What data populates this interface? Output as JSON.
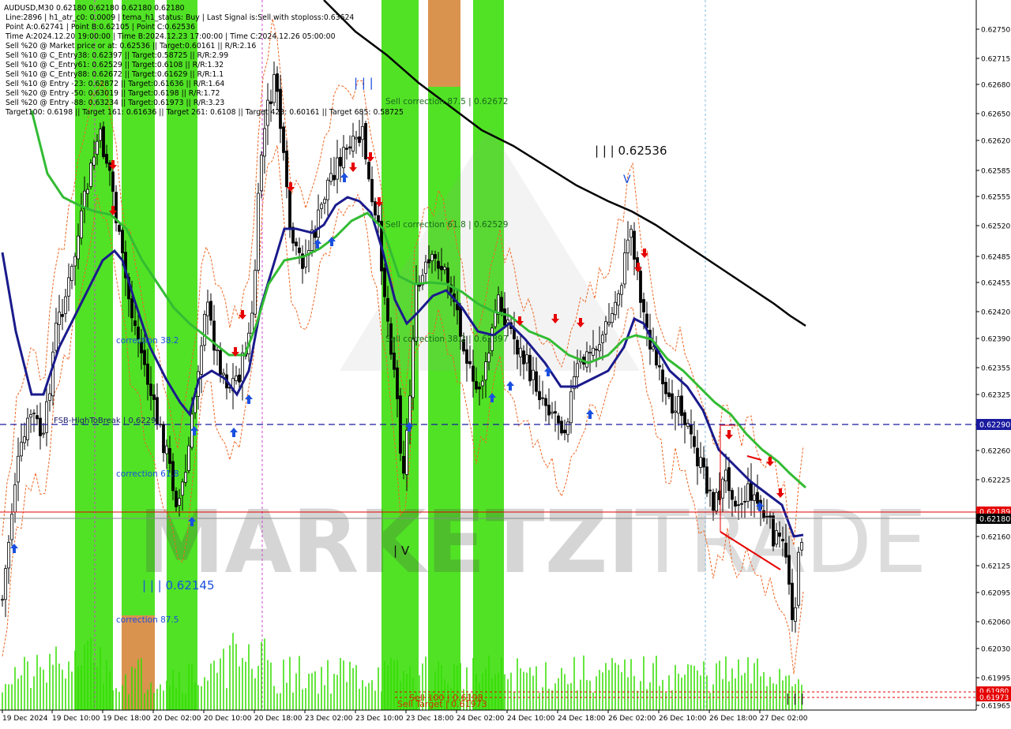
{
  "window": {
    "title": "AUDUSD,M30  0.62180 0.62180 0.62180 0.62180"
  },
  "info_lines": [
    "AUDUSD,M30  0.62180 0.62180 0.62180 0.62180",
    "Line:2896 | h1_atr_c0: 0.0009 | tema_h1_status: Buy | Last Signal is:Sell with stoploss:0.63624",
    "Point A:0.62741 | Point B:0.62105 | Point C:0.62536",
    "Time A:2024.12.20 19:00:00 | Time B:2024.12.23 17:00:00 | Time C:2024.12.26 05:00:00",
    "Sell %20 @ Market price or at: 0.62536 || Target:0.60161 || R/R:2.16",
    "Sell %10 @ C_Entry38: 0.62397 || Target:0.58725 || R/R:2.99",
    "Sell %10 @ C_Entry61: 0.62529 || Target:0.6108 || R/R:1.32",
    "Sell %10 @ C_Entry88: 0.62672 || Target:0.61629 || R/R:1.1",
    "Sell %10 @ Entry -23: 0.62872 || Target:0.61636 || R/R:1.64",
    "Sell %20 @ Entry -50: 0.63019 || Target:0.6198 || R/R:1.72",
    "Sell %20 @ Entry -88: 0.63234 || Target:0.61973 || R/R:3.23",
    "Target100: 0.6198 || Target 161: 0.61636 || Target 261: 0.6108 || Target 423: 0.60161 || Target 685: 0.58725"
  ],
  "watermark": {
    "text_left": "MARKETZI",
    "text_right": "TRADE"
  },
  "annotations": {
    "wave3_top": "| | |",
    "wave3_label": "| | | 0.62536",
    "wave3_low_label": "| | | 0.62145",
    "wave4_label": "| V",
    "wave_bottom": "| | |",
    "sell_corr_875": "Sell correction 87.5 | 0.62672",
    "sell_corr_618": "Sell correction 61.8 | 0.62529",
    "sell_corr_382": "Sell correction 38.2 | 0.62397",
    "corr_382": "correction 38.2",
    "corr_618": "correction 61.8",
    "corr_875": "correction 87.5",
    "fsb_label": "FSB-HighToBreak | 0.6229",
    "sell_100": "Sell 100 | 0.6198",
    "sell_target": "Sell Target | 0.61973"
  },
  "price_tags": {
    "fsb": "0.62290",
    "red_line": "0.62189",
    "current": "0.62180",
    "target_100": "0.61980",
    "target_2": "0.61973"
  },
  "colors": {
    "background": "#ffffff",
    "up_candle": "#000000",
    "down_candle": "#000000",
    "green_zone": "#33dd00",
    "orange_zone": "#d9934f",
    "ma_fast": "#1a1a8c",
    "ma_mid": "#33bb33",
    "ma_slow": "#000000",
    "fsb_line": "#1a1aa0",
    "sell_arrow": "#e60000",
    "buy_arrow": "#1a4fe0",
    "price_line": "#e60000",
    "volume": "#33dd00"
  },
  "chart_data": {
    "type": "candlestick",
    "symbol": "AUDUSD",
    "timeframe": "M30",
    "ylim": [
      0.6195,
      0.6277
    ],
    "y_ticks": [
      "0.62750",
      "0.62715",
      "0.62680",
      "0.62650",
      "0.62620",
      "0.62585",
      "0.62555",
      "0.62520",
      "0.62485",
      "0.62455",
      "0.62420",
      "0.62390",
      "0.62355",
      "0.62325",
      "0.62290",
      "0.62260",
      "0.62225",
      "0.62189",
      "0.62180",
      "0.62160",
      "0.62125",
      "0.62095",
      "0.62060",
      "0.62030",
      "0.61995",
      "0.61980",
      "0.61973",
      "0.61965"
    ],
    "x_ticks": [
      "19 Dec 2024",
      "19 Dec 10:00",
      "19 Dec 18:00",
      "20 Dec 02:00",
      "20 Dec 10:00",
      "20 Dec 18:00",
      "23 Dec 02:00",
      "23 Dec 10:00",
      "23 Dec 18:00",
      "24 Dec 02:00",
      "24 Dec 10:00",
      "24 Dec 18:00",
      "26 Dec 02:00",
      "26 Dec 10:00",
      "26 Dec 18:00",
      "27 Dec 02:00"
    ],
    "points": {
      "A": 0.62741,
      "B": 0.62105,
      "C": 0.62536
    },
    "levels": {
      "fsb_high_to_break": 0.6229,
      "current_price": 0.6218,
      "red_level": 0.62189,
      "sell_100": 0.6198,
      "sell_target": 0.61973
    },
    "last_close": 0.6218
  }
}
